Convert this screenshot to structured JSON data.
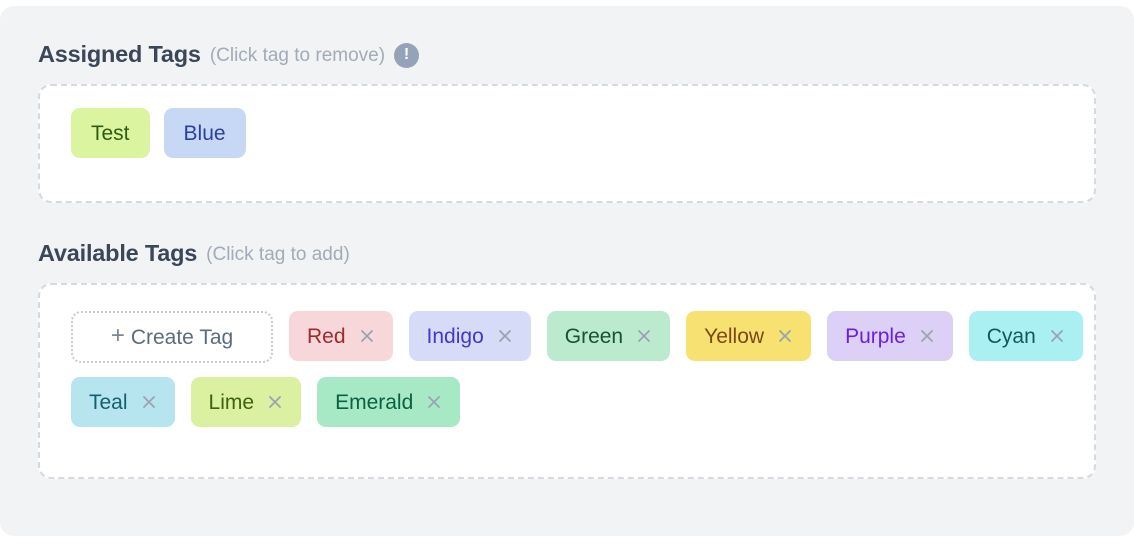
{
  "theme": {
    "page_bg": "#ffffff",
    "panel_bg": "#f1f3f5",
    "dropzone_bg": "#ffffff",
    "dropzone_border": "#d6dae0",
    "heading_color": "#3b4758",
    "hint_color": "#a2abb8",
    "info_icon_bg": "#94a3b8",
    "remove_icon_color": "#9aa3af",
    "create_border": "#c6ccd5",
    "create_text": "#5d6b80"
  },
  "assigned_section": {
    "title": "Assigned Tags",
    "hint": "(Click tag to remove)",
    "info_icon": "exclamation-circle-icon",
    "info_glyph": "!",
    "tags": [
      {
        "label": "Test",
        "bg": "#dbf4a0",
        "fg": "#2f5b14"
      },
      {
        "label": "Blue",
        "bg": "#c7d8f4",
        "fg": "#2b3f9e"
      }
    ]
  },
  "available_section": {
    "title": "Available Tags",
    "hint": "(Click tag to add)",
    "create_button": {
      "label": "Create Tag",
      "icon": "plus-icon",
      "icon_glyph": "+"
    },
    "remove_icon": "close-x-icon",
    "tags": [
      {
        "label": "Red",
        "bg": "#f7d7d9",
        "fg": "#9f2b2b"
      },
      {
        "label": "Indigo",
        "bg": "#d6dcf8",
        "fg": "#4338ca"
      },
      {
        "label": "Green",
        "bg": "#bceacf",
        "fg": "#17532f"
      },
      {
        "label": "Yellow",
        "bg": "#f7e171",
        "fg": "#7a4a13"
      },
      {
        "label": "Purple",
        "bg": "#ddd0f7",
        "fg": "#6b21d8"
      },
      {
        "label": "Cyan",
        "bg": "#aaf0f2",
        "fg": "#16565f"
      },
      {
        "label": "Teal",
        "bg": "#b6e4ef",
        "fg": "#15606f"
      },
      {
        "label": "Lime",
        "bg": "#dbf0a0",
        "fg": "#3f6212"
      },
      {
        "label": "Emerald",
        "bg": "#a8e9c5",
        "fg": "#0b5f43"
      }
    ]
  }
}
